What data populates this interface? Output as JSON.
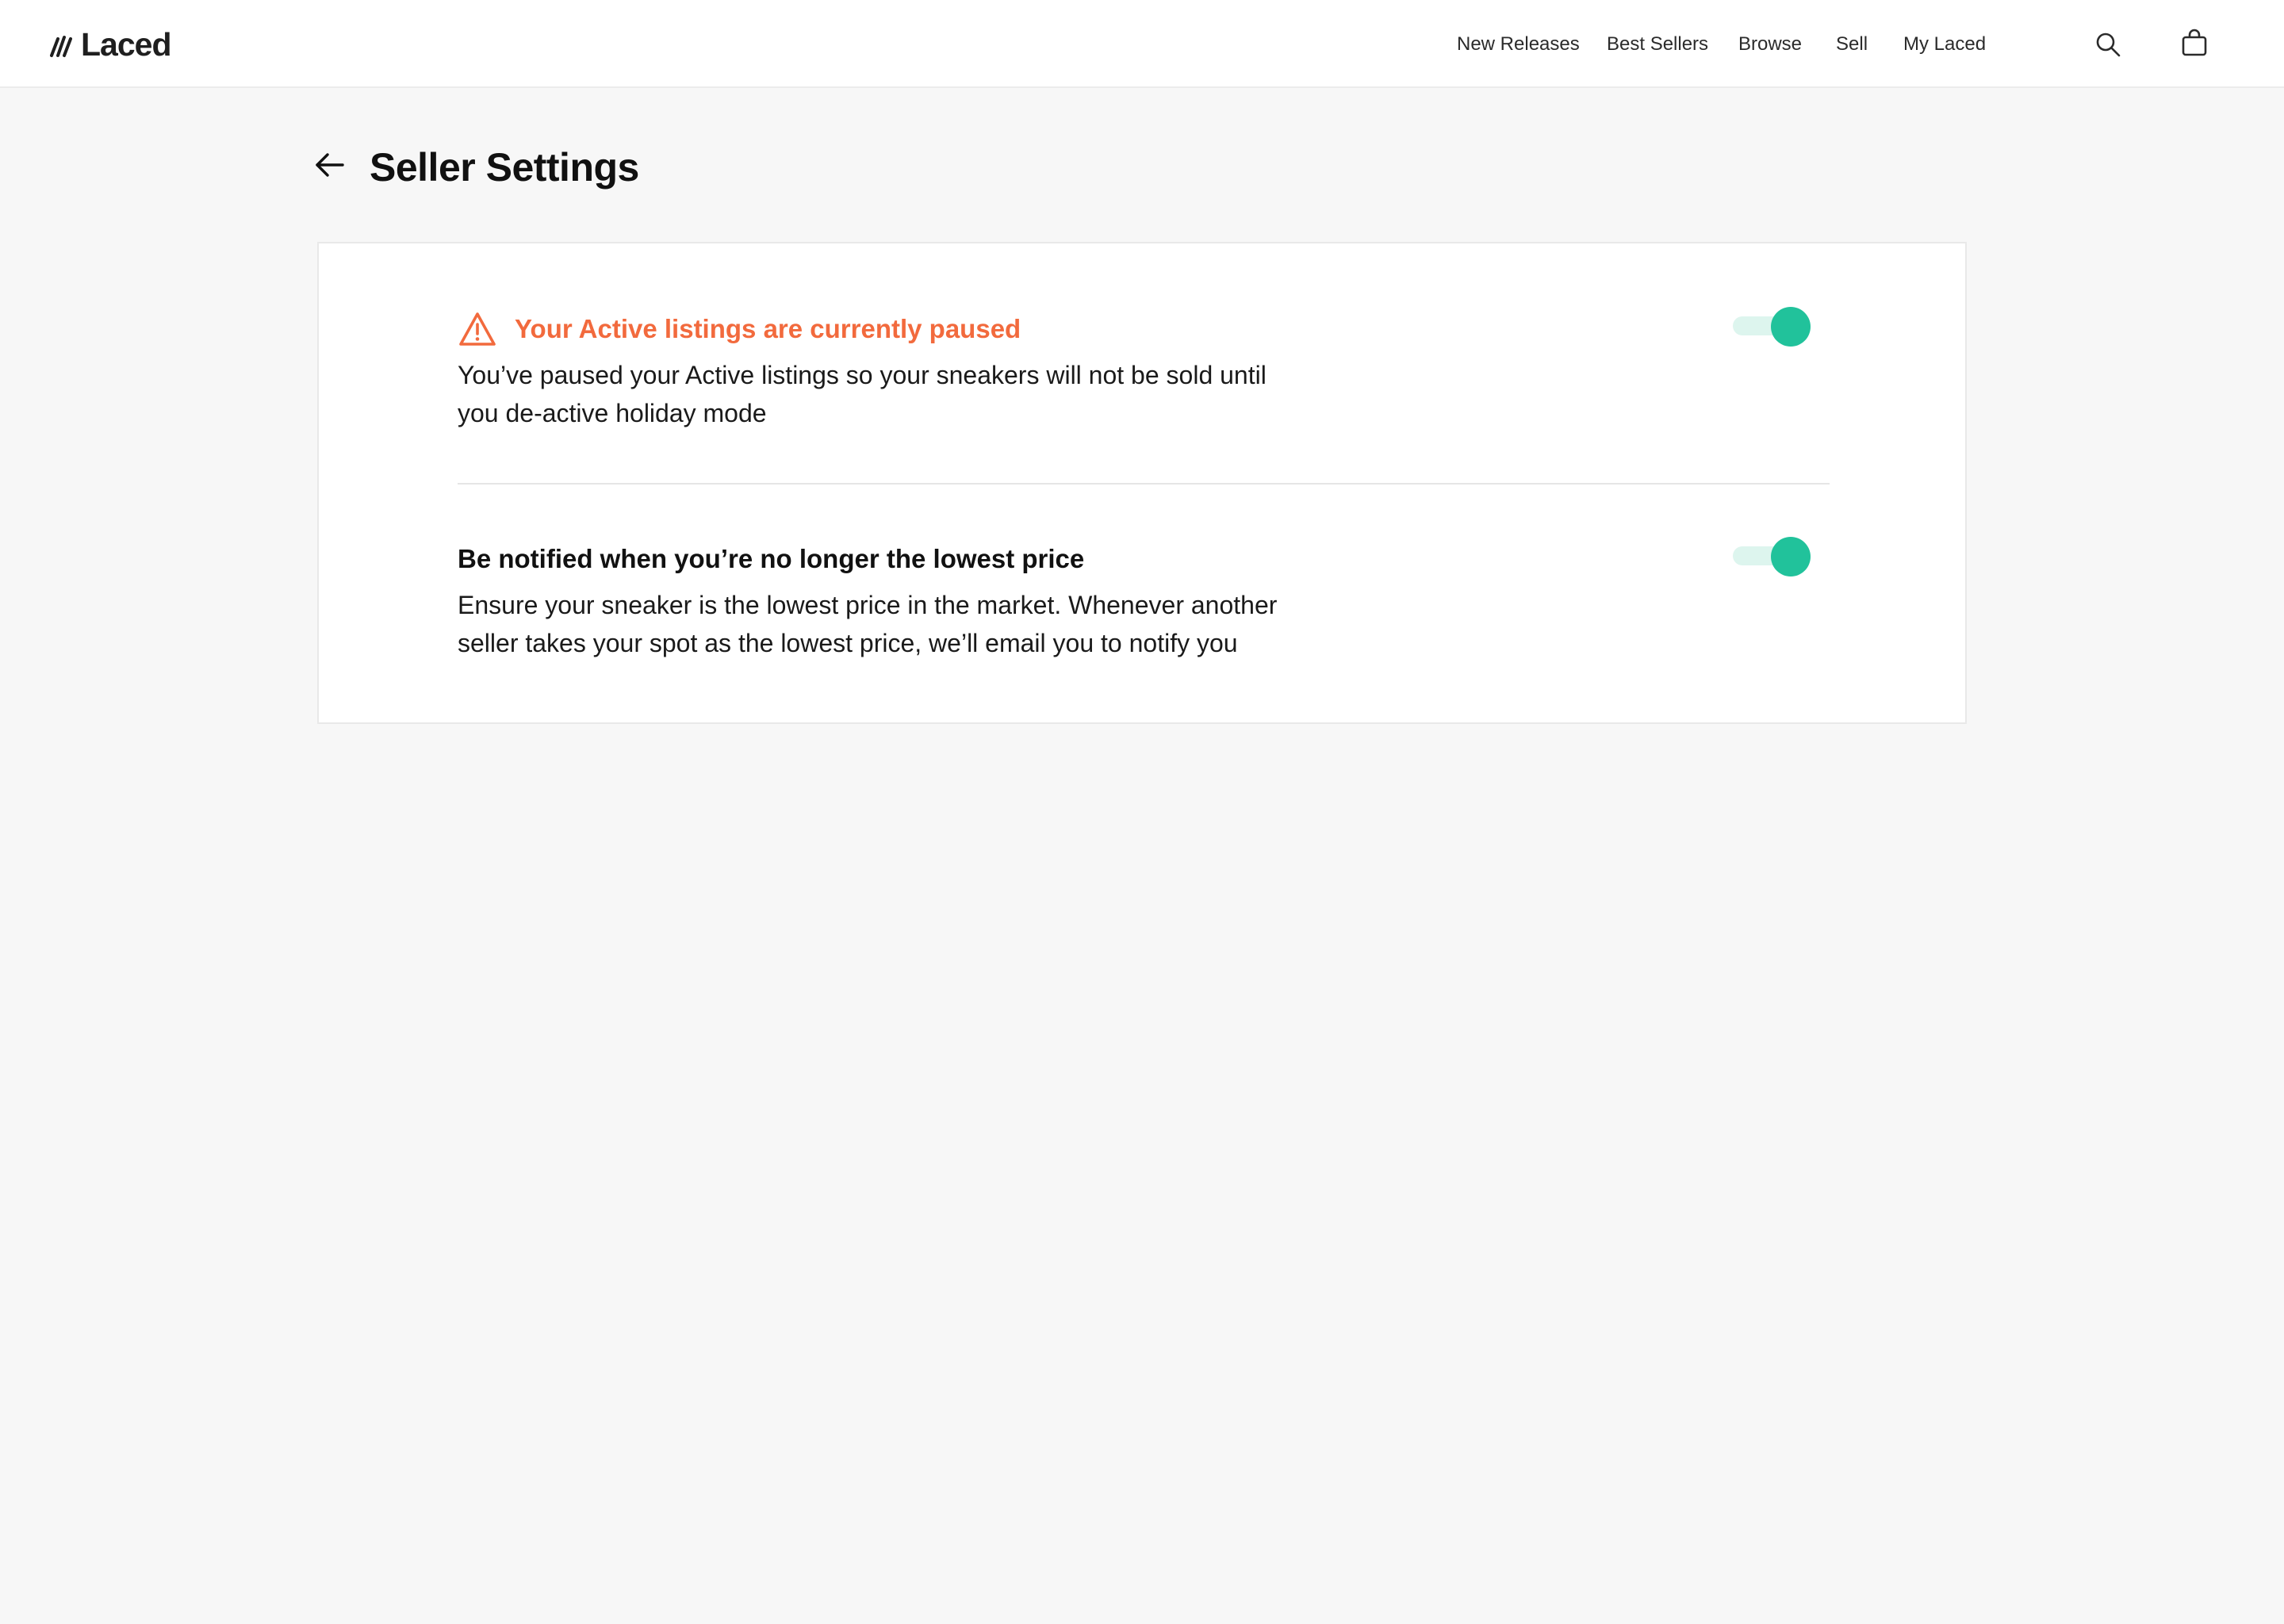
{
  "header": {
    "logo_text": "Laced",
    "nav": [
      {
        "label": "New Releases"
      },
      {
        "label": "Best Sellers"
      },
      {
        "label": "Browse"
      },
      {
        "label": "Sell"
      },
      {
        "label": "My Laced"
      }
    ],
    "icons": {
      "search": "search-icon",
      "bag": "shopping-bag-icon"
    }
  },
  "page": {
    "title": "Seller Settings",
    "back_icon": "arrow-left-icon"
  },
  "settings": [
    {
      "title": "Your Active listings are currently paused",
      "description": "You’ve paused your Active listings so your sneakers will not be sold until you de-active holiday mode",
      "icon": "warning-icon",
      "toggle_on": true
    },
    {
      "title": "Be notified when you’re no longer the lowest price",
      "description": "Ensure your sneaker is the lowest price in the market. Whenever another seller takes your spot as the lowest price, we’ll email you to notify you",
      "toggle_on": true
    }
  ],
  "colors": {
    "warning": "#f26a3d",
    "toggle_on": "#21c29b",
    "toggle_track": "#ddf5ee",
    "background": "#f7f7f7"
  }
}
